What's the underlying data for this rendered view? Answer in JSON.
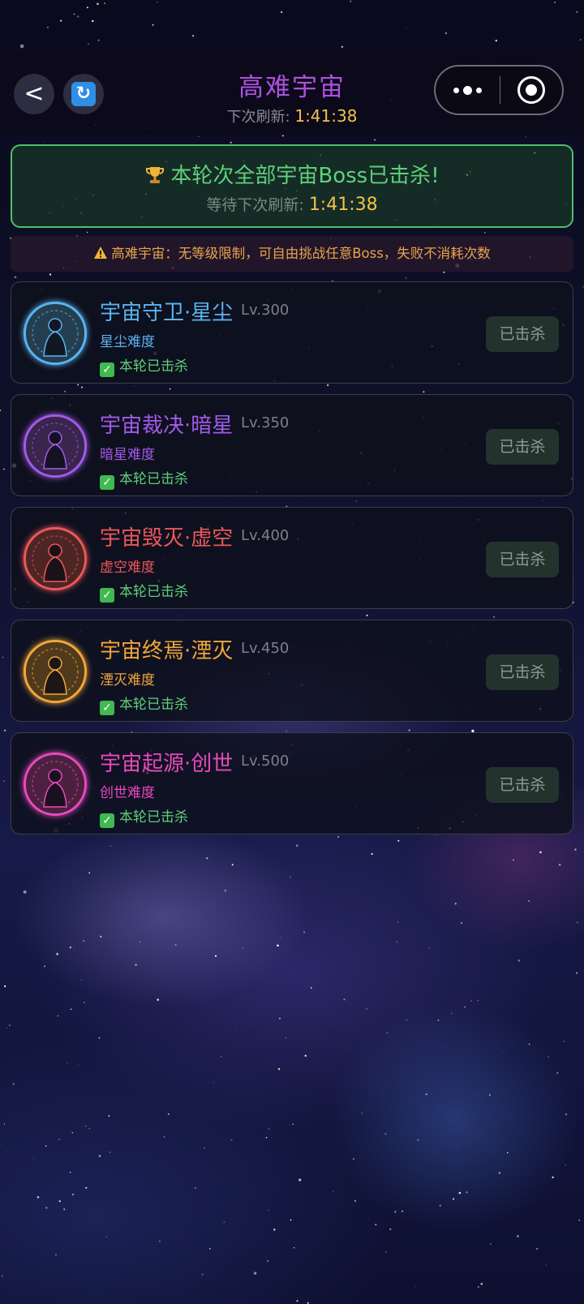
{
  "header": {
    "title": "高难宇宙",
    "refresh_label": "下次刷新: ",
    "refresh_time": "1:41:38",
    "back_icon": "chevron-left-icon",
    "refresh_icon": "refresh-icon",
    "more_icon": "more-dots-icon",
    "close_icon": "target-close-icon"
  },
  "banner": {
    "icon": "trophy-icon",
    "title": "本轮次全部宇宙Boss已击杀!",
    "wait_label": "等待下次刷新: ",
    "wait_time": "1:41:38"
  },
  "notice": {
    "icon": "warning-icon",
    "text": "高难宇宙：无等级限制，可自由挑战任意Boss，失败不消耗次数"
  },
  "bosses": [
    {
      "name": "宇宙守卫·星尘",
      "level": "Lv.300",
      "difficulty": "星尘难度",
      "status": "本轮已击杀",
      "button": "已击杀",
      "color": "#5ab4f0"
    },
    {
      "name": "宇宙裁决·暗星",
      "level": "Lv.350",
      "difficulty": "暗星难度",
      "status": "本轮已击杀",
      "button": "已击杀",
      "color": "#a25ae8"
    },
    {
      "name": "宇宙毁灭·虚空",
      "level": "Lv.400",
      "difficulty": "虚空难度",
      "status": "本轮已击杀",
      "button": "已击杀",
      "color": "#ec5858"
    },
    {
      "name": "宇宙终焉·湮灭",
      "level": "Lv.450",
      "difficulty": "湮灭难度",
      "status": "本轮已击杀",
      "button": "已击杀",
      "color": "#f2a63a"
    },
    {
      "name": "宇宙起源·创世",
      "level": "Lv.500",
      "difficulty": "创世难度",
      "status": "本轮已击杀",
      "button": "已击杀",
      "color": "#e74aba"
    }
  ]
}
